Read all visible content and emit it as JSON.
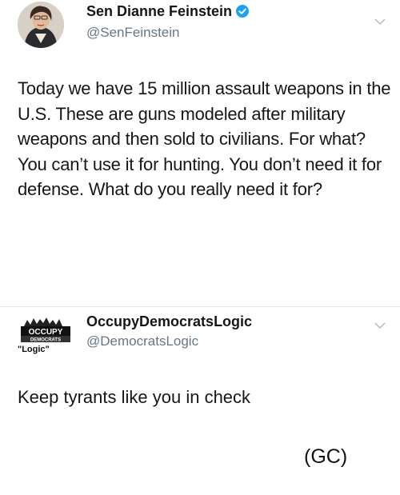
{
  "tweet": {
    "author_name": "Sen Dianne Feinstein",
    "author_handle": "@SenFeinstein",
    "verified": true,
    "verified_color": "#1da1f2",
    "avatar_icon": "avatar",
    "menu_icon": "chevron-down-icon",
    "text": "Today we have 15 million assault weapons in the U.S. These are guns modeled after military weapons and then sold to civilians. For what? You can’t use it for hunting. You don’t need it for defense. What do you really need it for?"
  },
  "reply": {
    "author_name": "OccupyDemocratsLogic",
    "author_handle": "@DemocratsLogic",
    "logo_word": "OCCUPY",
    "logo_subword": "DEMOCRATS",
    "logo_caption": "\"Logic\"",
    "menu_icon": "chevron-down-icon",
    "text": "Keep tyrants like you in check"
  },
  "caption": "(GC)",
  "colors": {
    "text_primary": "#14171a",
    "text_secondary": "#657786",
    "divider": "#e1e8ed"
  }
}
